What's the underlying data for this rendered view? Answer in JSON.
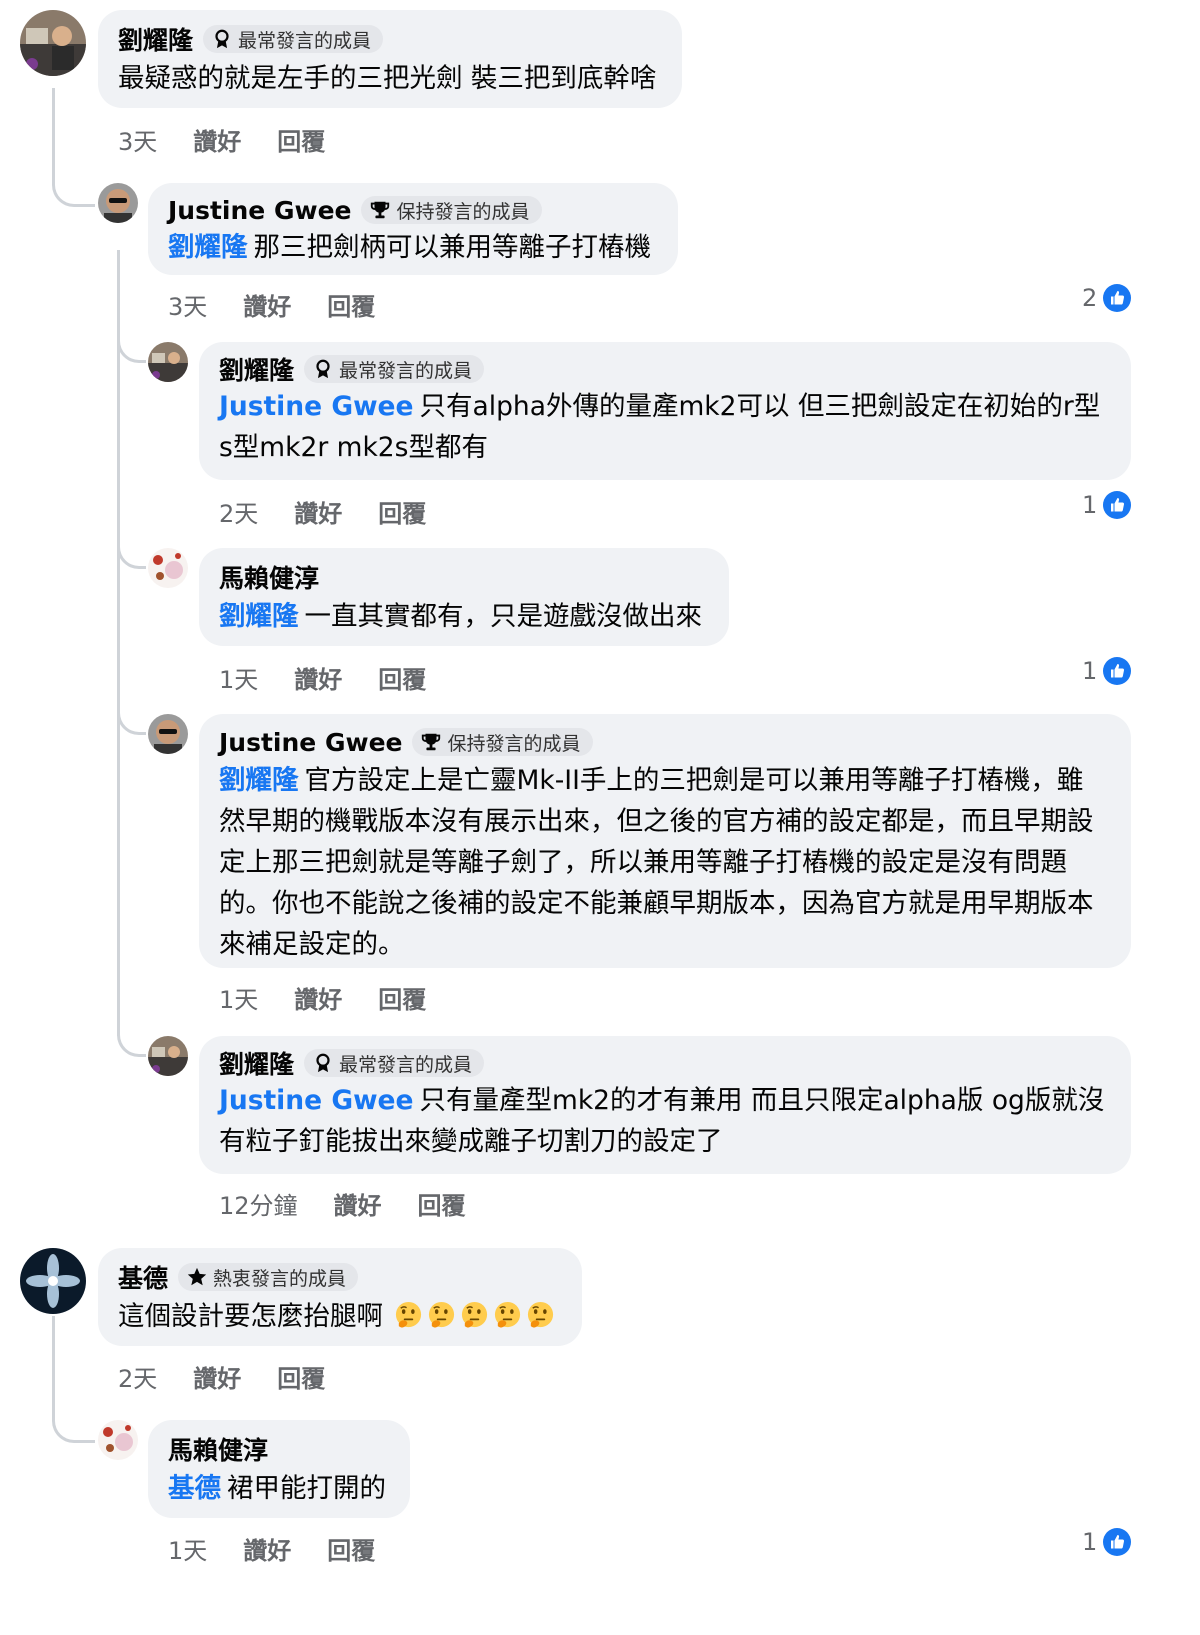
{
  "badges": {
    "top": "最常發言的成員",
    "rising": "保持發言的成員",
    "enthusiastic": "熱衷發言的成員"
  },
  "actions": {
    "like": "讚好",
    "reply": "回覆"
  },
  "colors": {
    "mention": "#1877f2",
    "bubble": "#f0f2f5",
    "like_blue": "#1877f2"
  },
  "comments": [
    {
      "author": "劉耀隆",
      "badge_icon": "award-ribbon-icon",
      "text": "最疑惑的就是左手的三把光劍 裝三把到底幹啥",
      "time": "3天"
    },
    {
      "author": "Justine Gwee",
      "badge_icon": "trophy-icon",
      "mention": "劉耀隆",
      "text": "那三把劍柄可以兼用等離子打樁機",
      "time": "3天",
      "likes": "2"
    },
    {
      "author": "劉耀隆",
      "badge_icon": "award-ribbon-icon",
      "mention": "Justine Gwee",
      "text": "只有alpha外傳的量產mk2可以 但三把劍設定在初始的r型 s型mk2r mk2s型都有",
      "time": "2天",
      "likes": "1"
    },
    {
      "author": "馬賴健淳",
      "mention": "劉耀隆",
      "text": "一直其實都有，只是遊戲沒做出來",
      "time": "1天",
      "likes": "1"
    },
    {
      "author": "Justine Gwee",
      "badge_icon": "trophy-icon",
      "mention": "劉耀隆",
      "text": "官方設定上是亡靈Mk-II手上的三把劍是可以兼用等離子打樁機，雖然早期的機戰版本沒有展示出來，但之後的官方補的設定都是，而且早期設定上那三把劍就是等離子劍了，所以兼用等離子打樁機的設定是沒有問題的。你也不能說之後補的設定不能兼顧早期版本，因為官方就是用早期版本來補足設定的。",
      "time": "1天"
    },
    {
      "author": "劉耀隆",
      "badge_icon": "award-ribbon-icon",
      "mention": "Justine Gwee",
      "text": "只有量產型mk2的才有兼用 而且只限定alpha版 og版就沒有粒子釘能拔出來變成離子切割刀的設定了",
      "time": "12分鐘"
    },
    {
      "author": "基德",
      "badge_icon": "star-icon",
      "text": "這個設計要怎麼抬腿啊",
      "emojis": [
        "thinking-face-icon",
        "thinking-face-icon",
        "thinking-face-icon",
        "thinking-face-icon",
        "thinking-face-icon"
      ],
      "time": "2天"
    },
    {
      "author": "馬賴健淳",
      "mention": "基德",
      "text": "裙甲能打開的",
      "time": "1天",
      "likes": "1"
    }
  ]
}
